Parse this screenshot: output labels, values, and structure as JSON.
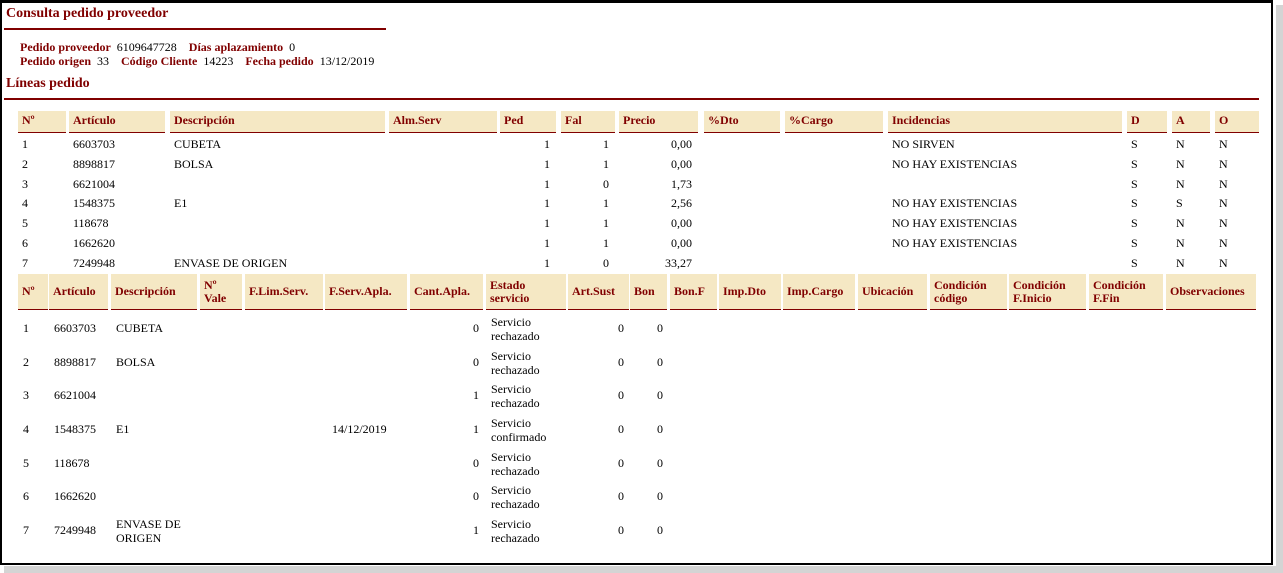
{
  "page_title": "Consulta pedido proveedor",
  "header": {
    "pedido_proveedor_label": "Pedido proveedor",
    "pedido_proveedor_value": "6109647728",
    "dias_aplazamiento_label": "Días aplazamiento",
    "dias_aplazamiento_value": "0",
    "pedido_origen_label": "Pedido origen",
    "pedido_origen_value": "33",
    "codigo_cliente_label": "Código Cliente",
    "codigo_cliente_value": "14223",
    "fecha_pedido_label": "Fecha pedido",
    "fecha_pedido_value": "13/12/2019"
  },
  "lineas_title": "Líneas pedido",
  "table1": {
    "headers": [
      "Nº",
      "Artículo",
      "Descripción",
      "Alm.Serv",
      "Ped",
      "Fal",
      "Precio",
      "%Dto",
      "%Cargo",
      "Incidencias",
      "D",
      "A",
      "O"
    ],
    "rows": [
      [
        "1",
        "6603703",
        "CUBETA",
        "",
        "1",
        "1",
        "0,00",
        "",
        "",
        "NO SIRVEN",
        "S",
        "N",
        "N"
      ],
      [
        "2",
        "8898817",
        "BOLSA",
        "",
        "1",
        "1",
        "0,00",
        "",
        "",
        "NO HAY EXISTENCIAS",
        "S",
        "N",
        "N"
      ],
      [
        "3",
        "6621004",
        "",
        "",
        "1",
        "0",
        "1,73",
        "",
        "",
        "",
        "S",
        "N",
        "N"
      ],
      [
        "4",
        "1548375",
        "E1",
        "",
        "1",
        "1",
        "2,56",
        "",
        "",
        "NO HAY EXISTENCIAS",
        "S",
        "S",
        "N"
      ],
      [
        "5",
        "118678",
        "",
        "",
        "1",
        "1",
        "0,00",
        "",
        "",
        "NO HAY EXISTENCIAS",
        "S",
        "N",
        "N"
      ],
      [
        "6",
        "1662620",
        "",
        "",
        "1",
        "1",
        "0,00",
        "",
        "",
        "NO HAY EXISTENCIAS",
        "S",
        "N",
        "N"
      ],
      [
        "7",
        "7249948",
        "ENVASE DE ORIGEN",
        "",
        "1",
        "0",
        "33,27",
        "",
        "",
        "",
        "S",
        "N",
        "N"
      ]
    ]
  },
  "table2": {
    "headers": [
      [
        "Nº"
      ],
      [
        "Artículo"
      ],
      [
        "Descripción"
      ],
      [
        "Nº",
        "Vale"
      ],
      [
        "F.Lim.Serv."
      ],
      [
        "F.Serv.Apla."
      ],
      [
        "Cant.Apla."
      ],
      [
        "Estado",
        "servicio"
      ],
      [
        "Art.Sust"
      ],
      [
        "Bon"
      ],
      [
        "Bon.F"
      ],
      [
        "Imp.Dto"
      ],
      [
        "Imp.Cargo"
      ],
      [
        "Ubicación"
      ],
      [
        "Condición",
        "código"
      ],
      [
        "Condición",
        "F.Inicio"
      ],
      [
        "Condición",
        "F.Fin"
      ],
      [
        "Observaciones"
      ]
    ],
    "rows": [
      {
        "n": "1",
        "articulo": "6603703",
        "descripcion": [
          "CUBETA"
        ],
        "fserv": "",
        "cant": "0",
        "estado": [
          "Servicio",
          "rechazado"
        ],
        "artsust": "0",
        "bon": "0"
      },
      {
        "n": "2",
        "articulo": "8898817",
        "descripcion": [
          "BOLSA"
        ],
        "fserv": "",
        "cant": "0",
        "estado": [
          "Servicio",
          "rechazado"
        ],
        "artsust": "0",
        "bon": "0"
      },
      {
        "n": "3",
        "articulo": "6621004",
        "descripcion": [
          ""
        ],
        "fserv": "",
        "cant": "1",
        "estado": [
          "Servicio",
          "rechazado"
        ],
        "artsust": "0",
        "bon": "0"
      },
      {
        "n": "4",
        "articulo": "1548375",
        "descripcion": [
          "E1"
        ],
        "fserv": "14/12/2019",
        "cant": "1",
        "estado": [
          "Servicio",
          "confirmado"
        ],
        "artsust": "0",
        "bon": "0"
      },
      {
        "n": "5",
        "articulo": "118678",
        "descripcion": [
          ""
        ],
        "fserv": "",
        "cant": "0",
        "estado": [
          "Servicio",
          "rechazado"
        ],
        "artsust": "0",
        "bon": "0"
      },
      {
        "n": "6",
        "articulo": "1662620",
        "descripcion": [
          ""
        ],
        "fserv": "",
        "cant": "0",
        "estado": [
          "Servicio",
          "rechazado"
        ],
        "artsust": "0",
        "bon": "0"
      },
      {
        "n": "7",
        "articulo": "7249948",
        "descripcion": [
          "ENVASE DE",
          "ORIGEN"
        ],
        "fserv": "",
        "cant": "1",
        "estado": [
          "Servicio",
          "rechazado"
        ],
        "artsust": "0",
        "bon": "0"
      }
    ]
  },
  "colors": {
    "accent": "#800000",
    "header_bg": "#f5e8c4"
  }
}
